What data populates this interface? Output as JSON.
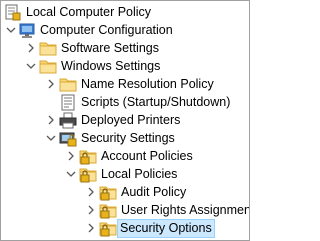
{
  "colors": {
    "folder_fill": "#f8d775",
    "folder_edge": "#d9a934",
    "lock_fill": "#e8b21c",
    "selection": "#cce8ff",
    "selection_border": "#99d1ff",
    "expander": "#5a5a5a"
  },
  "tree": {
    "items": [
      {
        "label": "Local Computer Policy",
        "icon": "policy-icon",
        "expander": "none"
      },
      {
        "label": "Computer Configuration",
        "icon": "computer-icon",
        "expander": "expanded"
      },
      {
        "label": "Software Settings",
        "icon": "folder-icon",
        "expander": "collapsed"
      },
      {
        "label": "Windows Settings",
        "icon": "folder-icon",
        "expander": "expanded"
      },
      {
        "label": "Name Resolution Policy",
        "icon": "folder-icon",
        "expander": "collapsed"
      },
      {
        "label": "Scripts (Startup/Shutdown)",
        "icon": "scripts-icon",
        "expander": "none"
      },
      {
        "label": "Deployed Printers",
        "icon": "printer-icon",
        "expander": "collapsed"
      },
      {
        "label": "Security Settings",
        "icon": "security-settings-icon",
        "expander": "expanded"
      },
      {
        "label": "Account Policies",
        "icon": "folder-lock-icon",
        "expander": "collapsed"
      },
      {
        "label": "Local Policies",
        "icon": "folder-lock-icon",
        "expander": "expanded"
      },
      {
        "label": "Audit Policy",
        "icon": "folder-lock-icon",
        "expander": "collapsed"
      },
      {
        "label": "User Rights Assignment",
        "icon": "folder-lock-icon",
        "expander": "collapsed"
      },
      {
        "label": "Security Options",
        "icon": "folder-lock-icon",
        "expander": "collapsed",
        "selected": true
      }
    ]
  }
}
